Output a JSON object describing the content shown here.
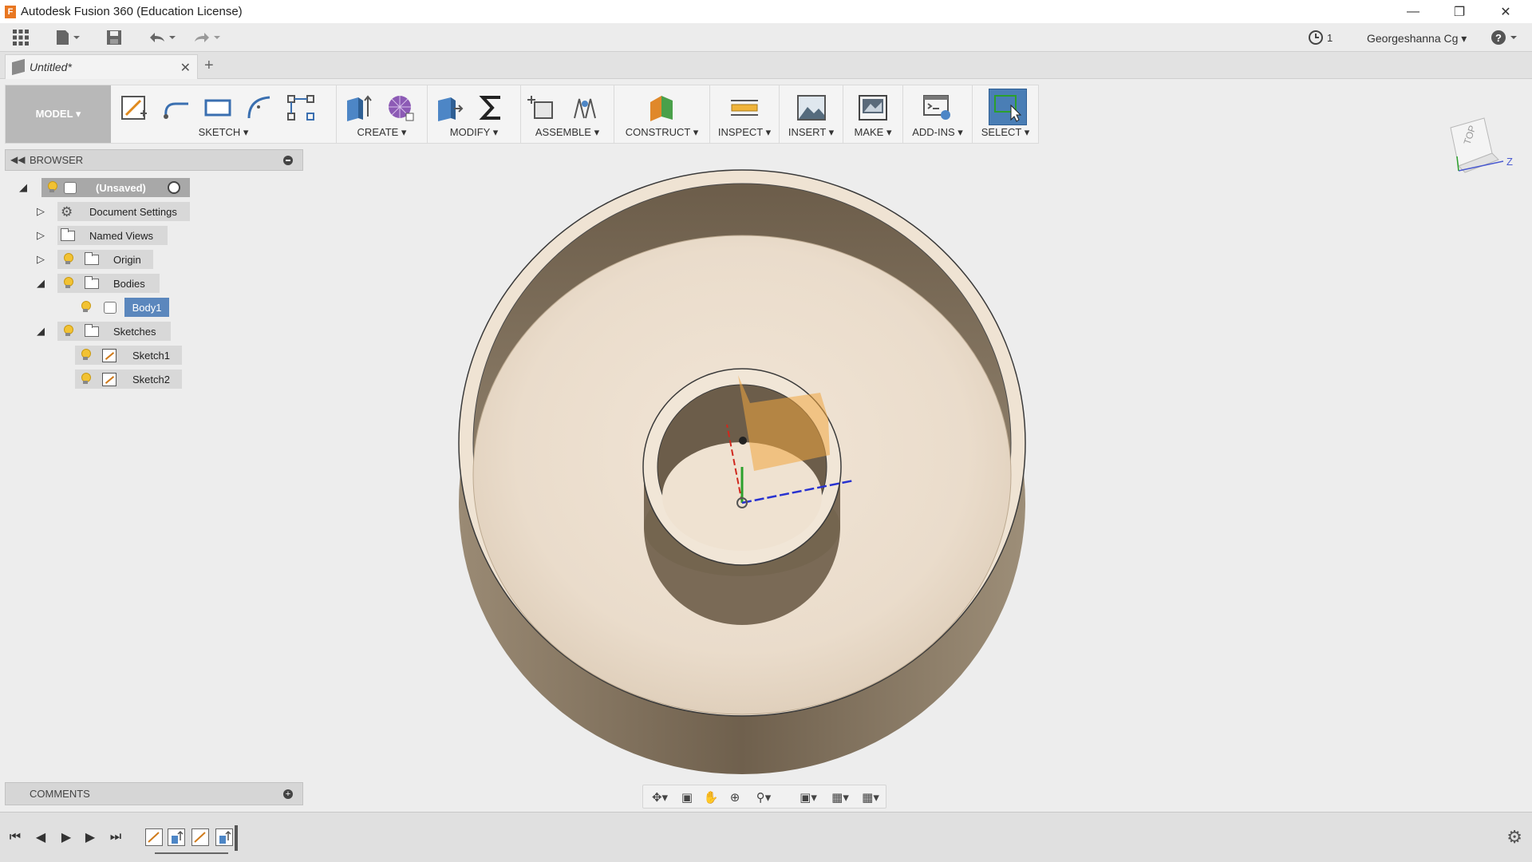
{
  "window": {
    "title": "Autodesk Fusion 360 (Education License)",
    "logo_letter": "F"
  },
  "quick_access": {
    "job_count": "1",
    "user_name": "Georgeshanna Cg ▾"
  },
  "tabs": [
    {
      "label": "Untitled*"
    }
  ],
  "toolbar": {
    "workspace": "MODEL ▾",
    "groups": [
      {
        "label": "SKETCH ▾"
      },
      {
        "label": "CREATE ▾"
      },
      {
        "label": "MODIFY ▾"
      },
      {
        "label": "ASSEMBLE ▾"
      },
      {
        "label": "CONSTRUCT ▾"
      },
      {
        "label": "INSPECT ▾"
      },
      {
        "label": "INSERT ▾"
      },
      {
        "label": "MAKE ▾"
      },
      {
        "label": "ADD-INS ▾"
      },
      {
        "label": "SELECT ▾"
      }
    ]
  },
  "browser": {
    "title": "BROWSER",
    "root": "(Unsaved)",
    "items": [
      {
        "label": "Document Settings"
      },
      {
        "label": "Named Views"
      },
      {
        "label": "Origin"
      },
      {
        "label": "Bodies"
      },
      {
        "label": "Body1"
      },
      {
        "label": "Sketches"
      },
      {
        "label": "Sketch1"
      },
      {
        "label": "Sketch2"
      }
    ]
  },
  "comments": {
    "title": "COMMENTS"
  },
  "viewcube": {
    "face_label": "TOP",
    "axis_label": "Z"
  },
  "colors": {
    "accent": "#4a7eb5",
    "part_face": "#efe3d3",
    "part_wall": "#7f705d",
    "selected_node": "#5b87bd"
  }
}
